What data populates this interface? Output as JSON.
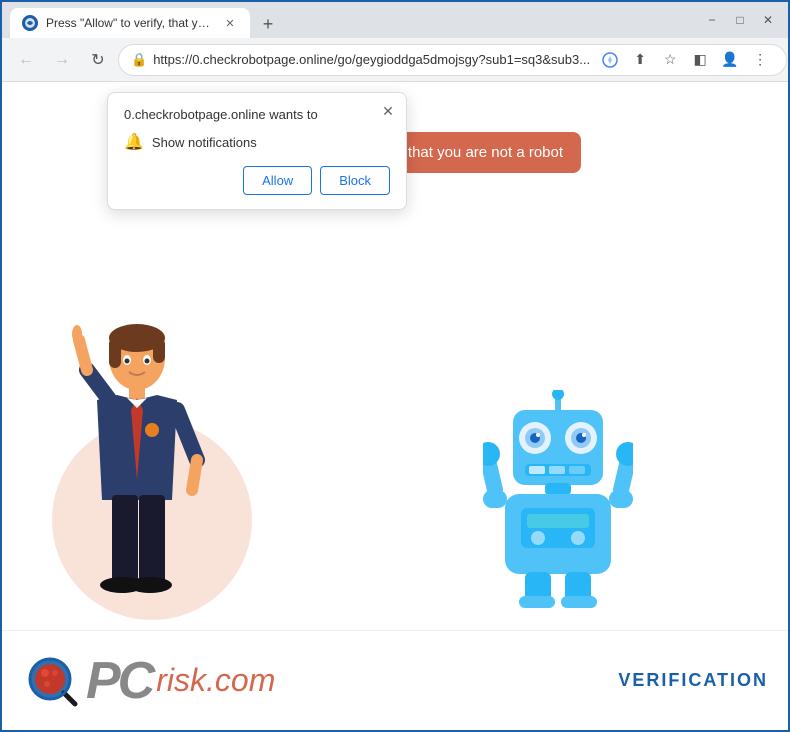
{
  "browser": {
    "tab_title": "Press \"Allow\" to verify, that you a...",
    "url": "https://0.checkrobotpage.online/go/geygioddga5dmojsgy?sub1=sq3&sub3...",
    "new_tab_label": "+",
    "window_minimize": "−",
    "window_maximize": "□",
    "window_close": "✕"
  },
  "nav": {
    "back_icon": "←",
    "forward_icon": "→",
    "reload_icon": "↻",
    "lock_icon": "🔒"
  },
  "popup": {
    "title": "0.checkrobotpage.online wants to",
    "notification_row_icon": "🔔",
    "notification_row_text": "Show notifications",
    "close_icon": "✕",
    "allow_label": "Allow",
    "block_label": "Block"
  },
  "page": {
    "speech_bubble_text": "Press \"Allow\" to verify, that you are not a robot"
  },
  "footer": {
    "logo_pc": "PC",
    "logo_risk": "risk",
    "logo_com": ".com",
    "verification": "VERIFICATION"
  }
}
